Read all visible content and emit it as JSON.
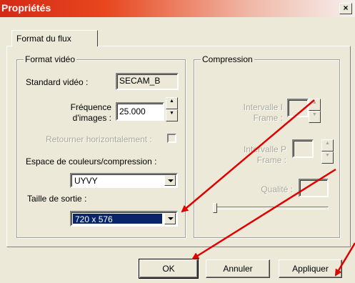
{
  "window": {
    "title": "Propriétés",
    "close_glyph": "×"
  },
  "tabs": [
    {
      "label": "Format du flux"
    }
  ],
  "format_video": {
    "group_label": "Format vidéo",
    "standard_label": "Standard vidéo :",
    "standard_value": "SECAM_B",
    "frequence_label_1": "Fréquence",
    "frequence_label_2": "d'images :",
    "frequence_value": "25.000",
    "retourner_label": "Retourner horizontalement :",
    "espace_label": "Espace de couleurs/compression :",
    "espace_value": "UYVY",
    "taille_label": "Taille de sortie :",
    "taille_value": "720 x 576"
  },
  "compression": {
    "group_label": "Compression",
    "intervalle_i_1": "Intervalle I",
    "intervalle_i_2": "Frame :",
    "intervalle_p_1": "Intervalle P",
    "intervalle_p_2": "Frame :",
    "qualite_label": "Qualité :"
  },
  "buttons": {
    "ok": "OK",
    "annuler": "Annuler",
    "appliquer": "Appliquer"
  },
  "annotation": {
    "arrow_color": "#e00000"
  }
}
